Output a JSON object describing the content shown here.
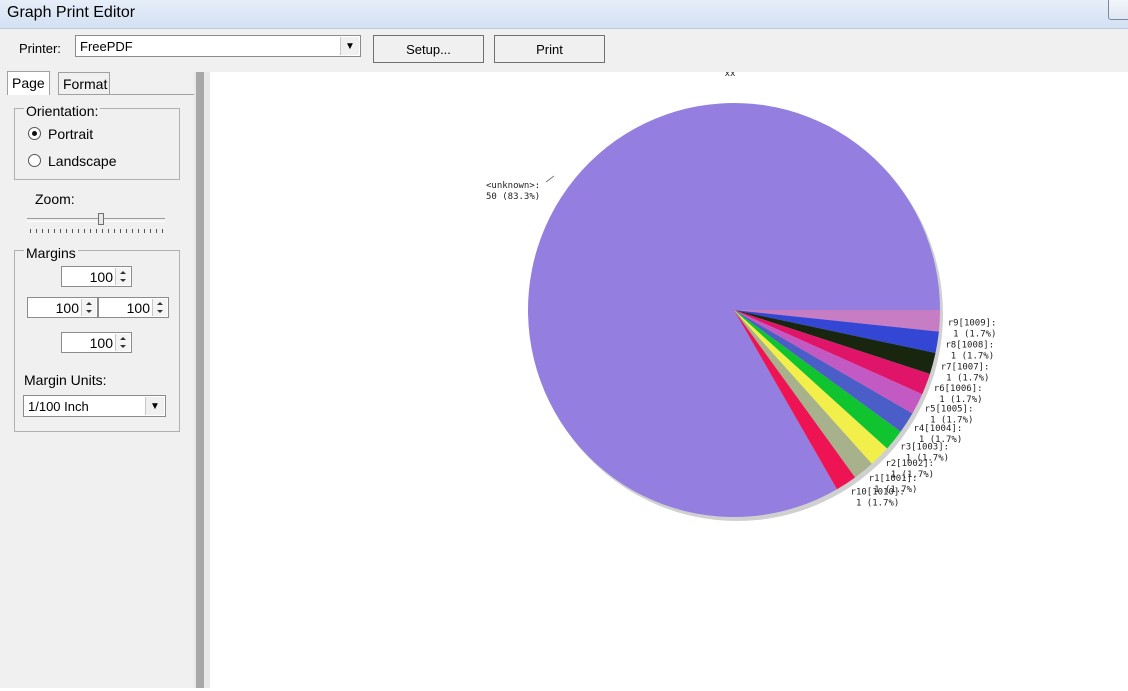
{
  "window": {
    "title": "Graph Print Editor"
  },
  "toolbar": {
    "printer_label": "Printer:",
    "printer_value": "FreePDF",
    "setup_label": "Setup...",
    "print_label": "Print"
  },
  "tabs": [
    {
      "label": "Page"
    },
    {
      "label": "Format"
    }
  ],
  "orientation": {
    "label": "Orientation:",
    "options": [
      {
        "label": "Portrait",
        "checked": true
      },
      {
        "label": "Landscape",
        "checked": false
      }
    ]
  },
  "zoom": {
    "label": "Zoom:"
  },
  "margins": {
    "label": "Margins",
    "top": "100",
    "left": "100",
    "right": "100",
    "bottom": "100"
  },
  "margin_units": {
    "label": "Margin Units:",
    "value": "1/100 Inch"
  },
  "chart_data": {
    "type": "pie",
    "title": "xx",
    "slices": [
      {
        "label": "<unknown>:",
        "value": 50,
        "text": "50 (83.3%)",
        "color": "#947ee0"
      },
      {
        "label": "r9[1009]:",
        "value": 1,
        "text": "1 (1.7%)",
        "color": "#c67dc3"
      },
      {
        "label": "r8[1008]:",
        "value": 1,
        "text": "1 (1.7%)",
        "color": "#3347d4"
      },
      {
        "label": "r7[1007]:",
        "value": 1,
        "text": "1 (1.7%)",
        "color": "#19260f"
      },
      {
        "label": "r6[1006]:",
        "value": 1,
        "text": "1 (1.7%)",
        "color": "#e0156a"
      },
      {
        "label": "r5[1005]:",
        "value": 1,
        "text": "1 (1.7%)",
        "color": "#c35ac3"
      },
      {
        "label": "r4[1004]:",
        "value": 1,
        "text": "1 (1.7%)",
        "color": "#4b5ec8"
      },
      {
        "label": "r3[1003]:",
        "value": 1,
        "text": "1 (1.7%)",
        "color": "#10c42f"
      },
      {
        "label": "r2[1002]:",
        "value": 1,
        "text": "1 (1.7%)",
        "color": "#f2ef4a"
      },
      {
        "label": "r1[1001]:",
        "value": 1,
        "text": "1 (1.7%)",
        "color": "#a7b28d"
      },
      {
        "label": "r10[1010]:",
        "value": 1,
        "text": "1 (1.7%)",
        "color": "#ee1453"
      }
    ]
  }
}
